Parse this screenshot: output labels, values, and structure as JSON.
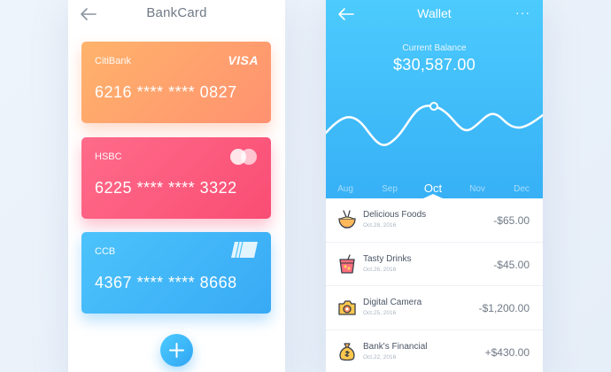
{
  "bankcard": {
    "title": "BankCard",
    "cards": [
      {
        "bank": "CitiBank",
        "number": "6216 **** **** 0827",
        "logo_text": "VISA",
        "logo_icon": "visa-logo"
      },
      {
        "bank": "HSBC",
        "number": "6225 **** **** 3322",
        "logo_icon": "mastercard-logo"
      },
      {
        "bank": "CCB",
        "number": "4367 **** **** 8668",
        "logo_icon": "card-chip-logo"
      }
    ],
    "add_icon": "plus-icon"
  },
  "wallet": {
    "title": "Wallet",
    "more_label": "···",
    "balance_label": "Current Balance",
    "balance_value": "$30,587.00",
    "months": [
      "Aug",
      "Sep",
      "Oct",
      "Nov",
      "Dec"
    ],
    "active_month": "Oct",
    "transactions": [
      {
        "name": "Delicious Foods",
        "date": "Oct.28, 2016",
        "amount": "-$65.00",
        "icon": "noodle-bowl-icon"
      },
      {
        "name": "Tasty Drinks",
        "date": "Oct.26, 2016",
        "amount": "-$45.00",
        "icon": "drink-cup-icon"
      },
      {
        "name": "Digital Camera",
        "date": "Oct.25, 2016",
        "amount": "-$1,200.00",
        "icon": "camera-icon"
      },
      {
        "name": "Bank's Financial",
        "date": "Oct.22, 2016",
        "amount": "+$430.00",
        "icon": "money-bag-icon"
      }
    ]
  },
  "colors": {
    "card_orange": "#ffa06d",
    "card_pink": "#fb5a7c",
    "card_blue": "#40b5f8",
    "wallet_blue": "#3fbcf9",
    "text_gray": "#707a86"
  }
}
